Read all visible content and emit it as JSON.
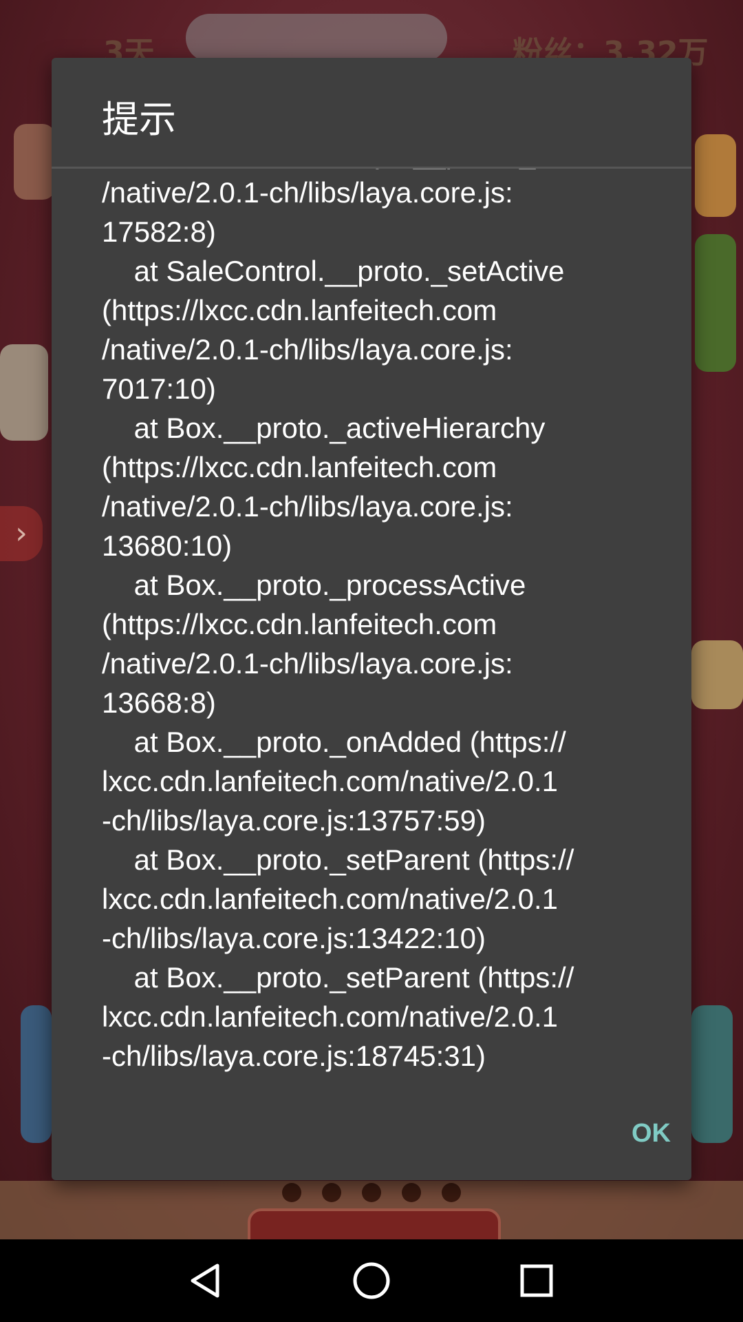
{
  "dialog": {
    "title": "提示",
    "message": "                          at Laya.__proto._onRender (https://lxcc.cdn.lanfeitech.com\n/native/2.0.1-ch/libs/laya.core.js:\n17582:8)\n    at SaleControl.__proto._setActive\n(https://lxcc.cdn.lanfeitech.com\n/native/2.0.1-ch/libs/laya.core.js:\n7017:10)\n    at Box.__proto._activeHierarchy\n(https://lxcc.cdn.lanfeitech.com\n/native/2.0.1-ch/libs/laya.core.js:\n13680:10)\n    at Box.__proto._processActive\n(https://lxcc.cdn.lanfeitech.com\n/native/2.0.1-ch/libs/laya.core.js:\n13668:8)\n    at Box.__proto._onAdded (https://\nlxcc.cdn.lanfeitech.com/native/2.0.1\n-ch/libs/laya.core.js:13757:59)\n    at Box.__proto._setParent (https://\nlxcc.cdn.lanfeitech.com/native/2.0.1\n-ch/libs/laya.core.js:13422:10)\n    at Box.__proto._setParent (https://\nlxcc.cdn.lanfeitech.com/native/2.0.1\n-ch/libs/laya.core.js:18745:31)",
    "ok_label": "OK"
  },
  "background": {
    "top_left_text": "3天",
    "top_right_text": "粉丝：3.32万"
  },
  "navbar": {
    "back_icon": "back-triangle-icon",
    "home_icon": "home-circle-icon",
    "recents_icon": "recents-square-icon"
  },
  "colors": {
    "dialog_bg": "#3f3f3f",
    "accent": "#80cbc4",
    "navbar_bg": "#000000"
  }
}
